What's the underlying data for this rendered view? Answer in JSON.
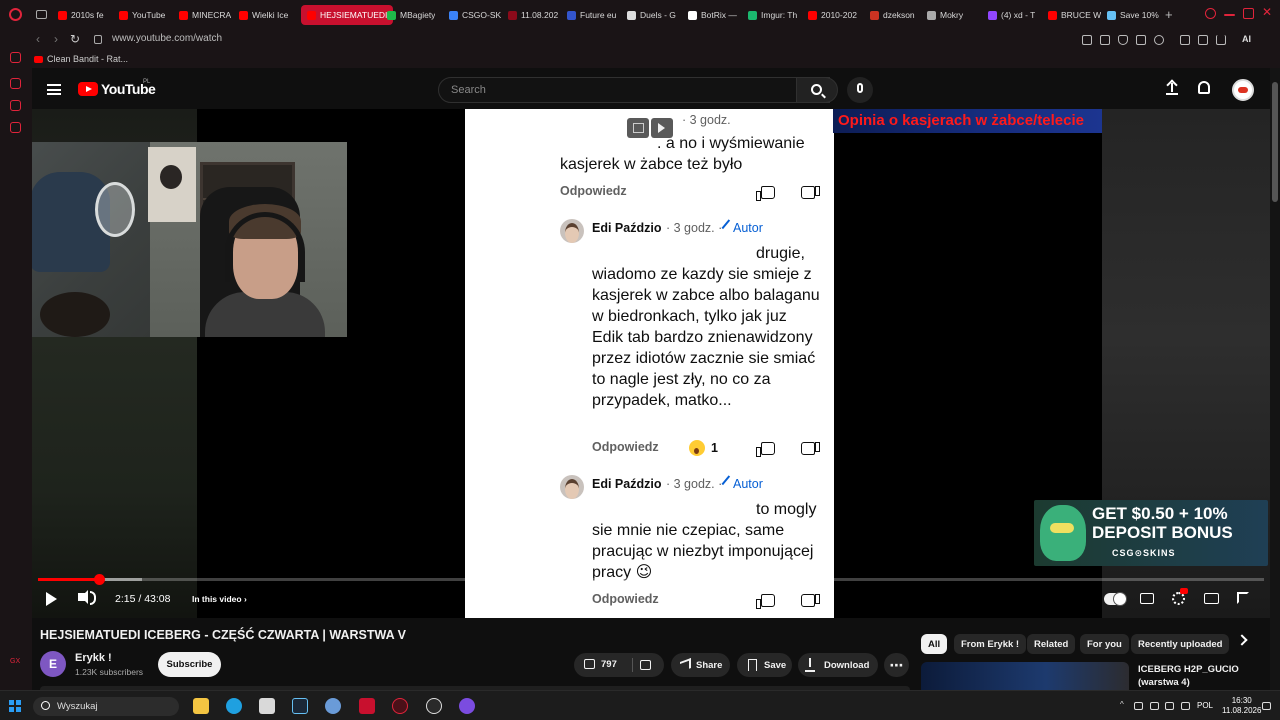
{
  "browser": {
    "tabs": [
      {
        "label": "2010s fe",
        "color": "#ff0000"
      },
      {
        "label": "YouTube",
        "color": "#ff0000"
      },
      {
        "label": "MINECRA",
        "color": "#ff0000"
      },
      {
        "label": "Wielki Ice",
        "color": "#ff0000"
      },
      {
        "label": "HEJSIEMATUEDI",
        "color": "#ff0000",
        "active": true
      },
      {
        "label": "MBagiety",
        "color": "#1fb84a"
      },
      {
        "label": "CSGO-SK",
        "color": "#3b82f6"
      },
      {
        "label": "11.08.202",
        "color": "#8b0a1a"
      },
      {
        "label": "Future eu",
        "color": "#3355cc"
      },
      {
        "label": "Duels - G",
        "color": "#dddddd"
      },
      {
        "label": "BotRix —",
        "color": "#ffffff"
      },
      {
        "label": "Imgur: Th",
        "color": "#1bb76e"
      },
      {
        "label": "2010-202",
        "color": "#ff0000"
      },
      {
        "label": "dzekson",
        "color": "#cc3322"
      },
      {
        "label": "Mokry",
        "color": "#aaaaaa"
      },
      {
        "label": "(4) xd - T",
        "color": "#9146ff"
      },
      {
        "label": "BRUCE W",
        "color": "#ff0000"
      },
      {
        "label": "Save 10%",
        "color": "#66c0f4"
      }
    ],
    "url": "www.youtube.com/watch",
    "toolbar_ai_label": "AI",
    "bookmark": "Clean Bandit - Rat..."
  },
  "youtube": {
    "logo_text": "YouTube",
    "region": "PL",
    "search_placeholder": "Search"
  },
  "comments": {
    "first": {
      "time": "· 3 godz.",
      "text_line1": ". a no i wyśmiewanie",
      "text_line2": "kasjerek w żabce też było",
      "reply_label": "Odpowiedz"
    },
    "second": {
      "author": "Edi Paździo",
      "time": "· 3 godz. ·",
      "badge": "Autor",
      "text": "drugie, wiadomo ze kazdy sie smieje z kasjerek w zabce albo balaganu w biedronkach, tylko jak juz Edik tab bardzo znienawidzony przez idiotów zacznie sie smiać to nagle jest zły, no co za przypadek, matko...",
      "reply_label": "Odpowiedz",
      "reaction_count": "1"
    },
    "third": {
      "author": "Edi Paździo",
      "time": "· 3 godz. ·",
      "badge": "Autor",
      "text": "to mogly sie mnie nie czepiac, same pracując w niezbyt imponującej pracy 😉",
      "reply_label": "Odpowiedz"
    }
  },
  "overlay": {
    "opinion_title": "Opinia o kasjerach w żabce/telecie"
  },
  "ad": {
    "line1": "GET $0.50 + 10%",
    "line2": "DEPOSIT BONUS",
    "brand": "CSG⊙SKINS"
  },
  "player": {
    "time": "2:15 / 43:08",
    "in_video": "In this video",
    "progress": 0.05,
    "buffered": 0.085
  },
  "video": {
    "title": "HEJSIEMATUEDI ICEBERG - CZĘŚĆ CZWARTA | WARSTWA V",
    "channel_initial": "E",
    "channel_name": "Erykk !",
    "subscribers": "1.23K subscribers",
    "subscribe_label": "Subscribe",
    "likes": "797",
    "share_label": "Share",
    "save_label": "Save",
    "download_label": "Download",
    "more_label": "⋯"
  },
  "chips": [
    "All",
    "From Erykk !",
    "Related",
    "For you",
    "Recently uploaded"
  ],
  "recommended": {
    "title": "ICEBERG H2P_GUCIO (warstwa 4)"
  },
  "taskbar": {
    "search_placeholder": "Wyszukaj",
    "lang": "POL",
    "time": "16:30",
    "date": "11.08.2026"
  }
}
